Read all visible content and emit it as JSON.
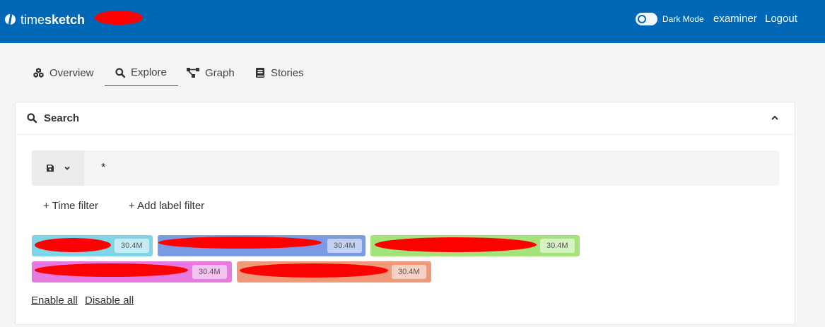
{
  "header": {
    "brand_prefix": "time",
    "brand_bold": "sketch",
    "dark_mode_label": "Dark Mode",
    "dark_mode_on": false,
    "username": "examiner",
    "logout_label": "Logout",
    "color": "#0068b7"
  },
  "tabs": [
    {
      "label": "Overview",
      "icon": "cubes-icon",
      "active": false
    },
    {
      "label": "Explore",
      "icon": "search-icon",
      "active": true
    },
    {
      "label": "Graph",
      "icon": "graph-icon",
      "active": false
    },
    {
      "label": "Stories",
      "icon": "book-icon",
      "active": false
    }
  ],
  "search_panel": {
    "title": "Search",
    "query": "*",
    "time_filter_label": "+ Time filter",
    "label_filter_label": "+ Add label filter",
    "enable_all_label": "Enable all",
    "disable_all_label": "Disable all"
  },
  "timelines": [
    {
      "count": "30.4M",
      "color": "#7fd6e8"
    },
    {
      "count": "30.4M",
      "color": "#7b9ae4"
    },
    {
      "count": "30.4M",
      "color": "#a4e27a"
    },
    {
      "count": "30.4M",
      "color": "#e879e0"
    },
    {
      "count": "30.4M",
      "color": "#f0987a"
    }
  ]
}
